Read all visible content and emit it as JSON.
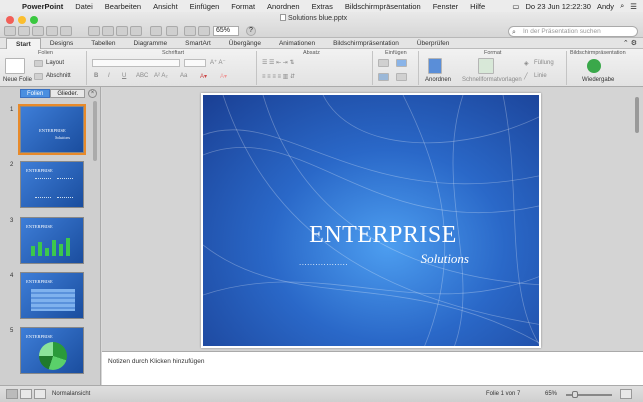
{
  "menubar": {
    "items": [
      "PowerPoint",
      "Datei",
      "Bearbeiten",
      "Ansicht",
      "Einfügen",
      "Format",
      "Anordnen",
      "Extras",
      "Bildschirmpräsentation",
      "Fenster",
      "Hilfe"
    ],
    "clock": "Do 23 Jun  12:22:30",
    "user": "Andy"
  },
  "window": {
    "title": "Solutions blue.pptx",
    "zoom_value": "65%",
    "search_placeholder": "In der Präsentation suchen"
  },
  "ribbon": {
    "tabs": [
      "Start",
      "Designs",
      "Tabellen",
      "Diagramme",
      "SmartArt",
      "Übergänge",
      "Animationen",
      "Bildschirmpräsentation",
      "Überprüfen"
    ],
    "groups": {
      "folien": "Folien",
      "schriftart": "Schriftart",
      "absatz": "Absatz",
      "einfuegen": "Einfügen",
      "format": "Format",
      "bildschirm": "Bildschirmpräsentation"
    },
    "buttons": {
      "neue_folie": "Neue Folie",
      "layout": "Layout",
      "abschnitt": "Abschnitt",
      "anordnen": "Anordnen",
      "schnellformat": "Schnellformatvorlagen",
      "fuellung": "Füllung",
      "linie": "Linie",
      "wiedergabe": "Wiedergabe"
    }
  },
  "left_pane": {
    "tabs": [
      "Folien",
      "Glieder."
    ],
    "slide_numbers": [
      "1",
      "2",
      "3",
      "4",
      "5"
    ],
    "thumb_title": "ENTERPRISE",
    "thumb_subtitle": "Solutions"
  },
  "slide": {
    "title": "ENTERPRISE",
    "dots": "..................",
    "subtitle": "Solutions"
  },
  "notes": {
    "placeholder": "Notizen durch Klicken hinzufügen"
  },
  "statusbar": {
    "view": "Normalansicht",
    "slide_info": "Folie 1 von 7",
    "zoom": "65%"
  },
  "colors": {
    "accent": "#4a8fe0",
    "slide_blue": "#2a68c8",
    "selection": "#e88a2a"
  }
}
